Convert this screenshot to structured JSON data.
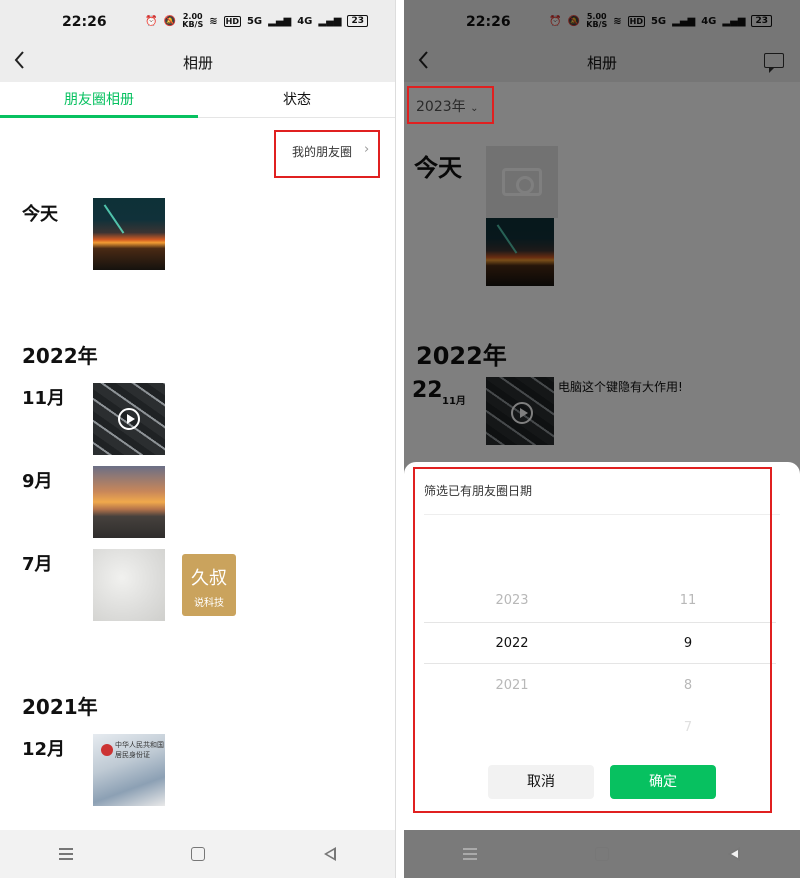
{
  "status": {
    "time": "22:26",
    "left_speed": "2.00",
    "right_speed": "5.00",
    "speed_unit": "KB/S",
    "hd": "HD",
    "net1": "5G",
    "net2": "4G",
    "battery": "23"
  },
  "nav": {
    "title": "相册"
  },
  "tabs": [
    {
      "label": "朋友圈相册"
    },
    {
      "label": "状态"
    }
  ],
  "left": {
    "my_moments": "我的朋友圈",
    "today": "今天",
    "year_2022": "2022年",
    "nov": "11月",
    "sep": "9月",
    "jul": "7月",
    "year_2021": "2021年",
    "dec": "12月",
    "gold_big": "久叔",
    "gold_small": "说科技",
    "idcard_text": "中华人民共和国 居民身份证"
  },
  "right": {
    "year_select": "2023年",
    "today": "今天",
    "year_2022": "2022年",
    "day": "22",
    "month": "11月",
    "post_text": "电脑这个键隐有大作用!",
    "sheet_title": "筛选已有朋友圈日期",
    "picker": {
      "years": [
        "2023",
        "2022",
        "2021"
      ],
      "months": [
        "11",
        "9",
        "8",
        "7"
      ]
    },
    "cancel": "取消",
    "confirm": "确定"
  },
  "colors": {
    "accent": "#07c160",
    "highlight": "#e02020"
  },
  "icons": [
    "back-icon",
    "chevron-right-icon",
    "chevron-down-icon",
    "comment-icon",
    "menu-icon",
    "home-icon",
    "triangle-back-icon",
    "play-icon",
    "camera-icon",
    "alarm-icon",
    "mute-icon",
    "wifi-icon",
    "signal-icon",
    "battery-icon"
  ]
}
